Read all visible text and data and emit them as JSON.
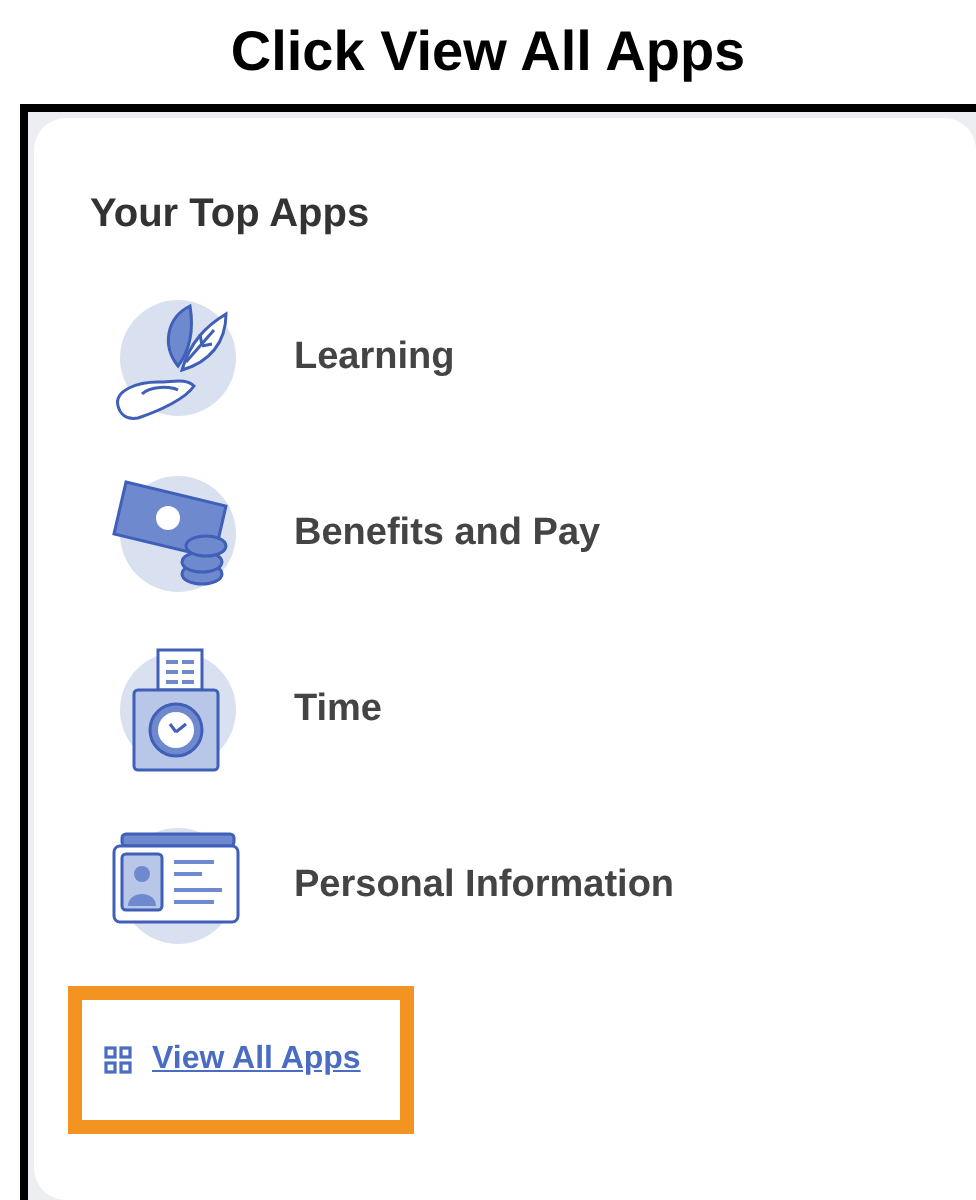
{
  "caption": "Click View All Apps",
  "card": {
    "title": "Your Top Apps",
    "apps": [
      {
        "label": "Learning",
        "kind": "leaf"
      },
      {
        "label": "Benefits and Pay",
        "kind": "money"
      },
      {
        "label": "Time",
        "kind": "clock"
      },
      {
        "label": "Personal Information",
        "kind": "badge"
      }
    ],
    "link": {
      "label": "View All Apps",
      "highlighted": true
    }
  }
}
